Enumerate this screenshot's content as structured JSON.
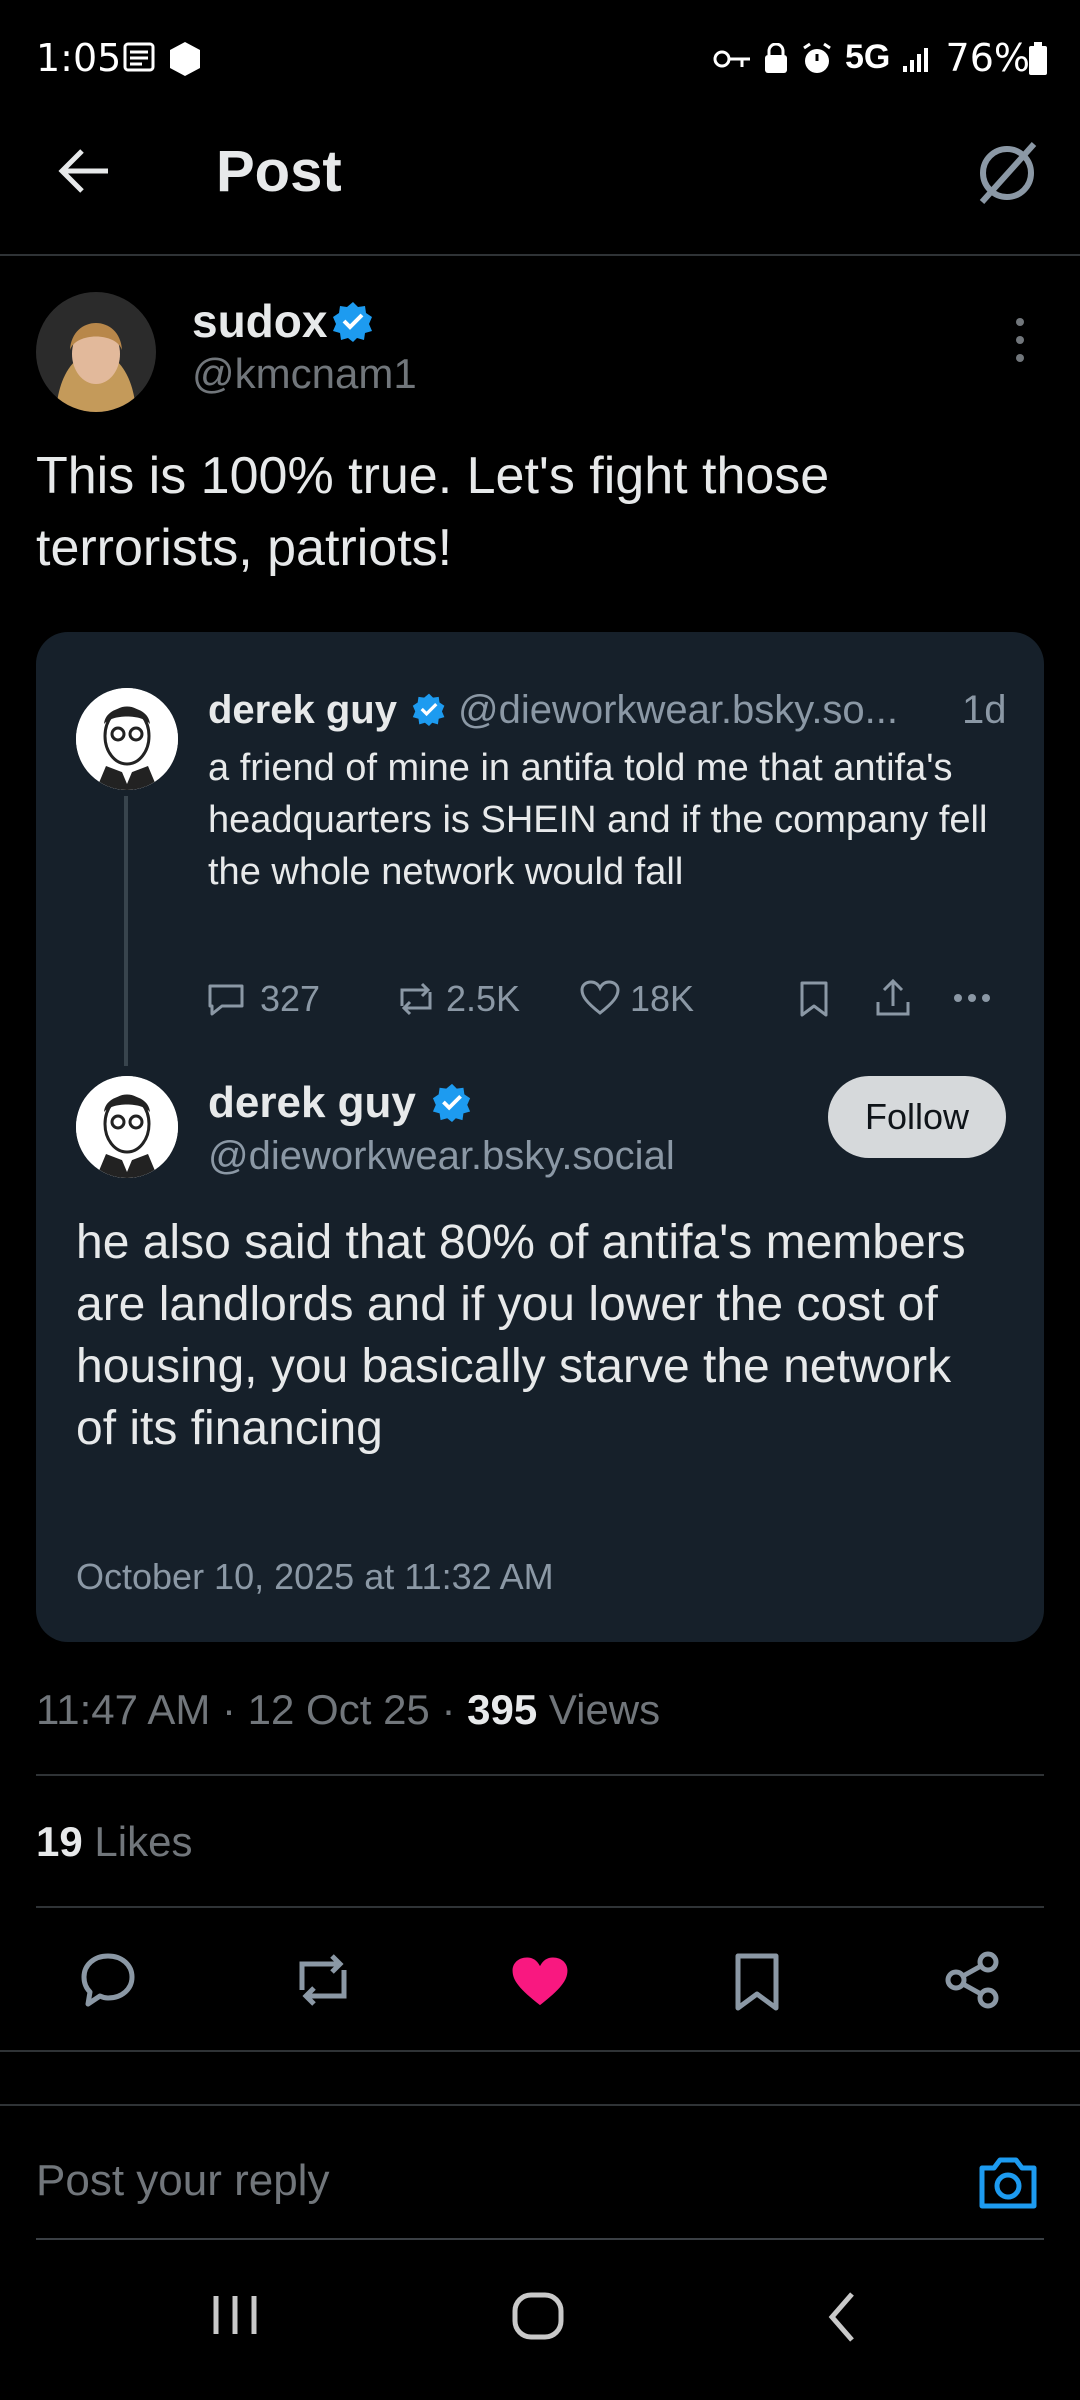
{
  "status_bar": {
    "time": "1:05",
    "network": "5G",
    "battery": "76%"
  },
  "header": {
    "title": "Post"
  },
  "post": {
    "author_name": "sudox",
    "author_handle": "@kmcnam1",
    "text": "This is 100% true. Let's fight those terrorists, patriots!",
    "time": "11:47 AM",
    "date": "12 Oct 25",
    "views_count": "395",
    "views_label": "Views",
    "likes_count": "19",
    "likes_label": "Likes"
  },
  "quote": {
    "parent": {
      "author_name": "derek guy",
      "author_handle": "@dieworkwear.bsky.so...",
      "age": "1d",
      "text": "a friend of mine in antifa told me that antifa's headquarters is SHEIN and if the company fell the whole network would fall",
      "replies": "327",
      "reposts": "2.5K",
      "likes": "18K"
    },
    "main": {
      "author_name": "derek guy",
      "author_handle": "@dieworkwear.bsky.social",
      "follow_label": "Follow",
      "text": "he also said that 80% of antifa's members are landlords and if you lower the cost of housing, you basically starve the network of its financing",
      "date": "October 10, 2025 at 11:32 AM"
    }
  },
  "reply": {
    "placeholder": "Post your reply"
  },
  "colors": {
    "accent": "#1d9bf0",
    "like": "#f91880",
    "background": "#000000",
    "card": "#16202a"
  }
}
